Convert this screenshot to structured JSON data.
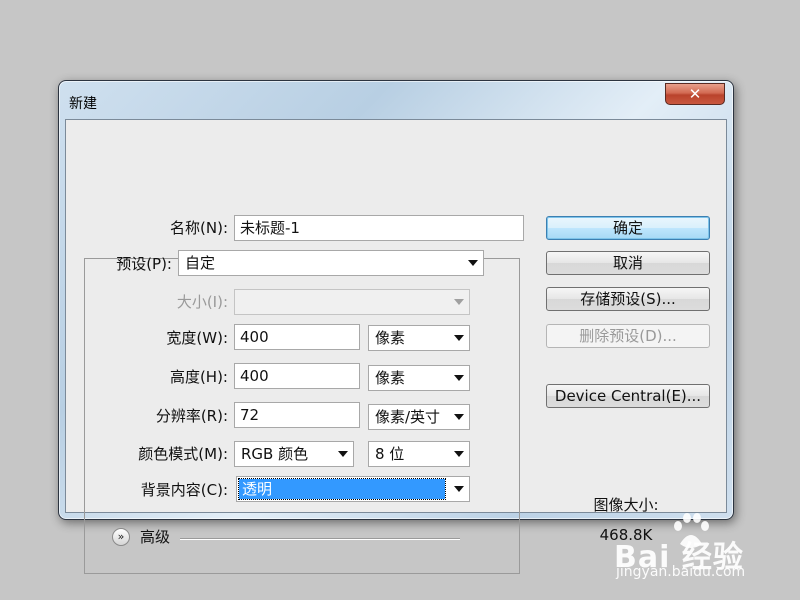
{
  "window": {
    "title": "新建",
    "close_glyph": "✕"
  },
  "form": {
    "name": {
      "label": "名称(N):",
      "value": "未标题-1"
    },
    "preset": {
      "label": "预设(P):",
      "value": "自定"
    },
    "size": {
      "label": "大小(I):",
      "value": ""
    },
    "width": {
      "label": "宽度(W):",
      "value": "400",
      "unit": "像素"
    },
    "height": {
      "label": "高度(H):",
      "value": "400",
      "unit": "像素"
    },
    "resolution": {
      "label": "分辨率(R):",
      "value": "72",
      "unit": "像素/英寸"
    },
    "color_mode": {
      "label": "颜色模式(M):",
      "value": "RGB 颜色",
      "depth": "8 位"
    },
    "background": {
      "label": "背景内容(C):",
      "value": "透明"
    },
    "advanced": {
      "label": "高级",
      "icon": "chevron-double-down-icon"
    }
  },
  "buttons": {
    "ok": "确定",
    "cancel": "取消",
    "save_preset": "存储预设(S)...",
    "delete_preset": "删除预设(D)...",
    "device_central": "Device Central(E)..."
  },
  "image_size": {
    "label": "图像大小:",
    "value": "468.8K"
  },
  "watermark": {
    "main": "Bai  经验",
    "sub": "jingyan.baidu.com"
  },
  "colors": {
    "selection": "#3399ff",
    "close_button": "#c9583f",
    "default_button": "#bee6fd"
  }
}
